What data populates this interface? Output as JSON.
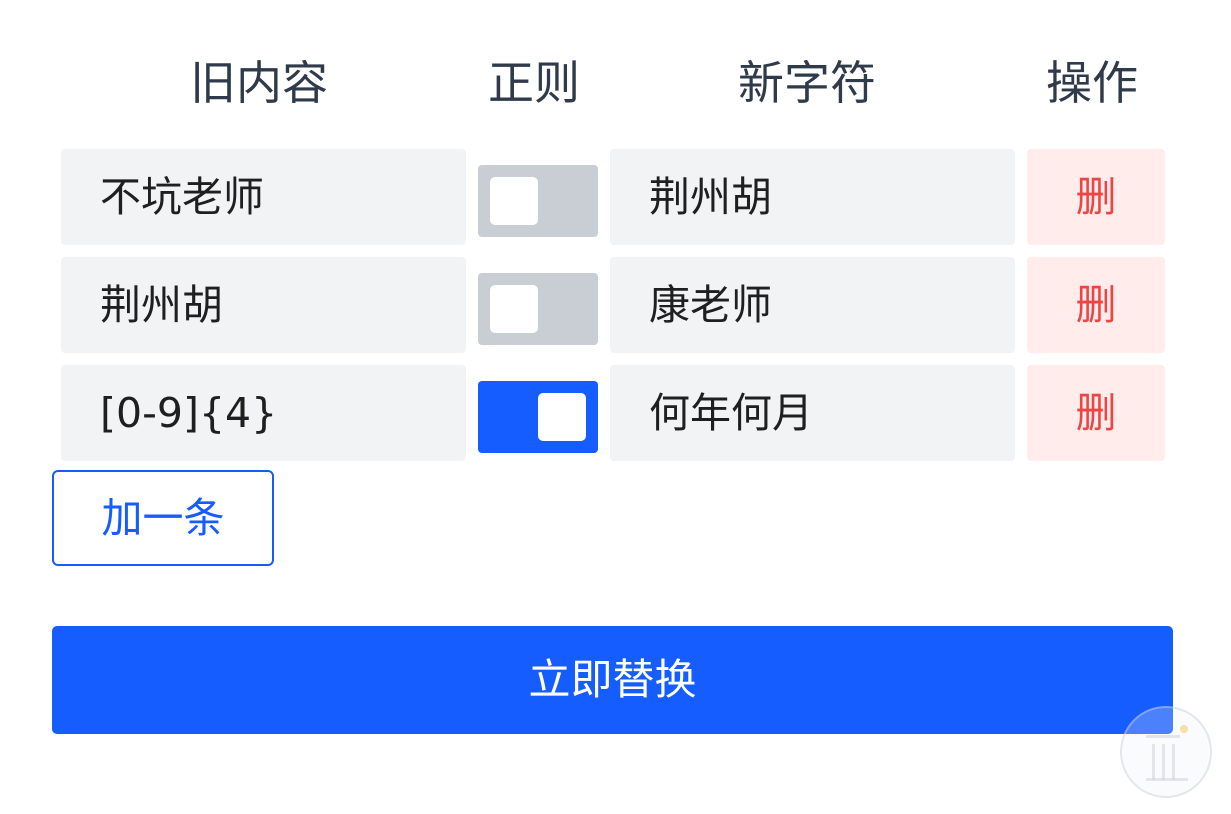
{
  "header": {
    "old_content": "旧内容",
    "regex": "正则",
    "new_chars": "新字符",
    "action": "操作"
  },
  "rows": [
    {
      "old": "不坑老师",
      "regex_enabled": false,
      "new": "荆州胡",
      "delete_label": "删"
    },
    {
      "old": "荆州胡",
      "regex_enabled": false,
      "new": "康老师",
      "delete_label": "删"
    },
    {
      "old": "[0-9]{4}",
      "regex_enabled": true,
      "new": "何年何月",
      "delete_label": "删"
    }
  ],
  "add_button": {
    "label": "加一条"
  },
  "submit_button": {
    "label": "立即替换"
  },
  "colors": {
    "primary": "#165dff",
    "danger_text": "#f04444",
    "danger_bg": "#ffeceb",
    "field_bg": "#f2f3f5",
    "toggle_off": "#c9cdd4"
  }
}
